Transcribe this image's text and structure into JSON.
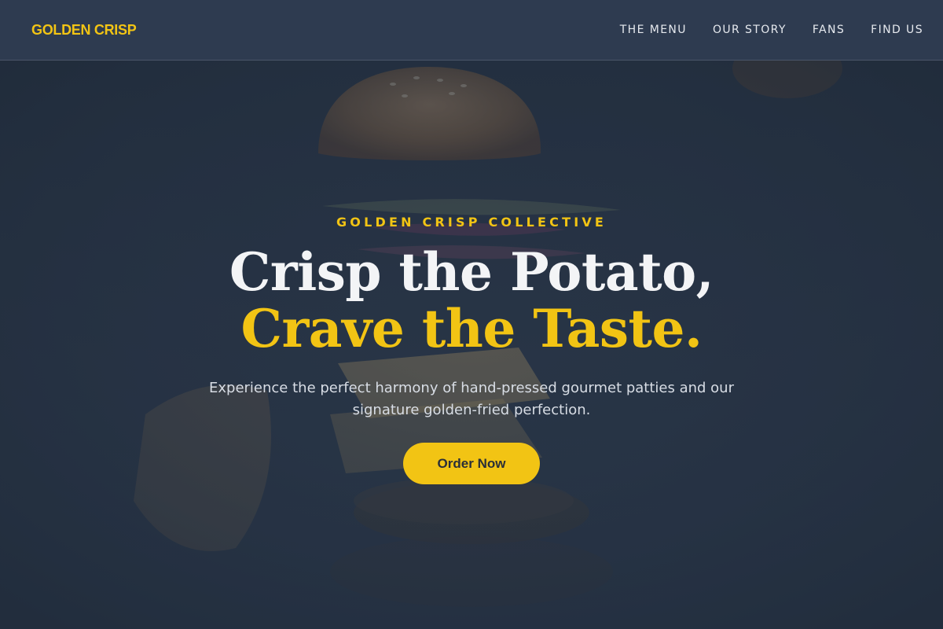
{
  "header": {
    "brand": "GOLDEN CRISP",
    "nav": [
      {
        "label": "THE MENU"
      },
      {
        "label": "OUR STORY"
      },
      {
        "label": "FANS"
      },
      {
        "label": "FIND US"
      }
    ]
  },
  "hero": {
    "eyebrow": "GOLDEN CRISP COLLECTIVE",
    "headline_line1": "Crisp the Potato,",
    "headline_line2": "Crave the Taste.",
    "subtitle": "Experience the perfect harmony of hand-pressed gourmet patties and our signature golden-fried perfection.",
    "cta_label": "Order Now",
    "background_image": "floating-burger-ingredients-photo"
  },
  "colors": {
    "accent": "#f2c414",
    "header_bg": "#2e3b50",
    "hero_bg": "#243142",
    "text_light": "#f3f4f6"
  }
}
